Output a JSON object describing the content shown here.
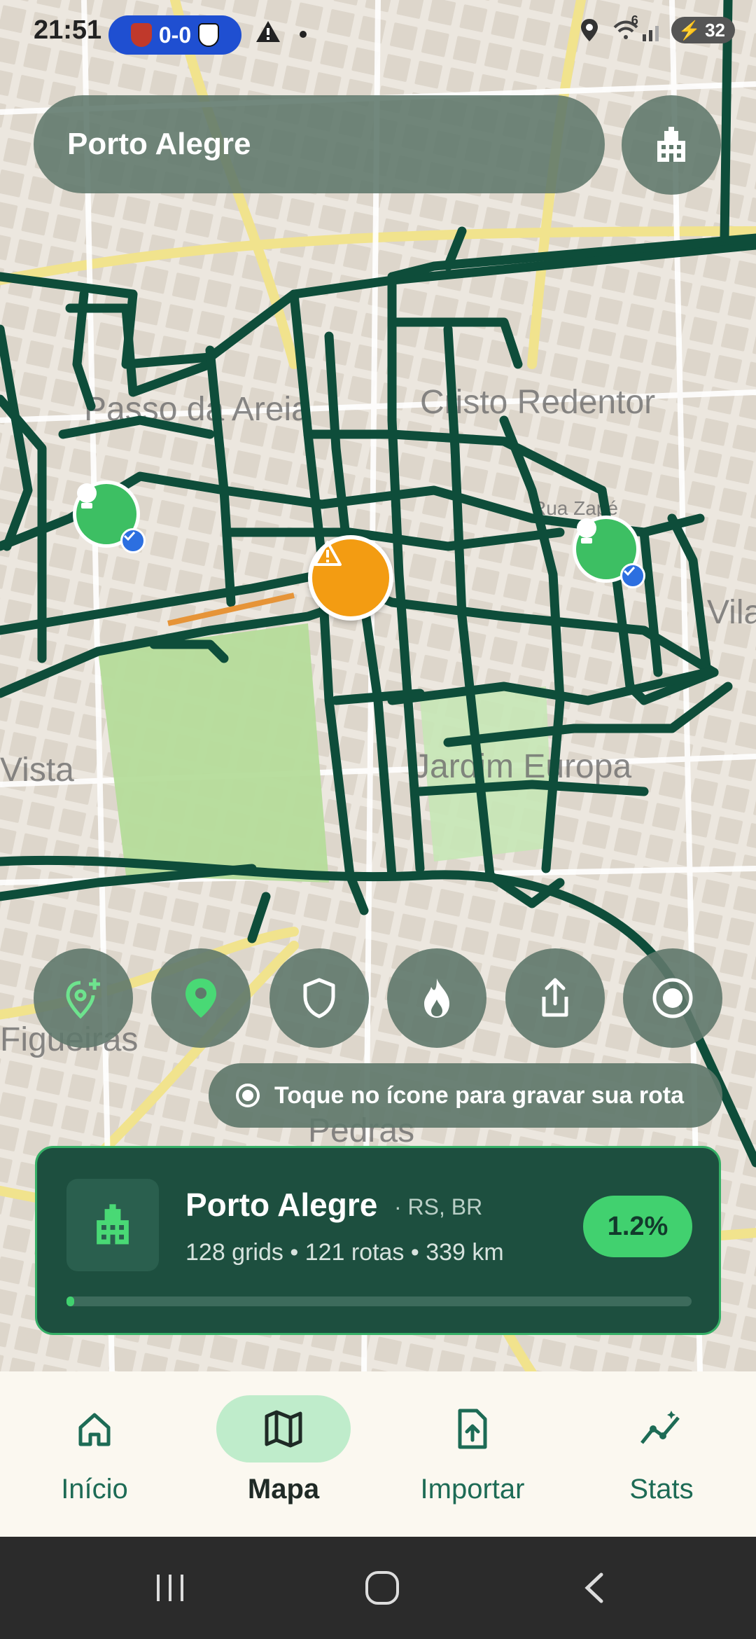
{
  "status_bar": {
    "time": "21:51",
    "score": "0-0",
    "network_label": "6",
    "battery": "32"
  },
  "search": {
    "city": "Porto Alegre"
  },
  "map": {
    "labels": [
      "Passo da Areia",
      "Cristo Redentor",
      "Rua Zapé",
      "Vila",
      "Vista",
      "Jardim Europa",
      "Figueiras",
      "Pedras"
    ],
    "route_color": "#0e4d3a"
  },
  "hint": {
    "text": "Toque no ícone para gravar sua rota"
  },
  "city_card": {
    "name": "Porto Alegre",
    "region": "· RS, BR",
    "stats": "128 grids • 121 rotas • 339 km",
    "percent_label": "1.2%",
    "progress_fraction": 0.012
  },
  "bottom_nav": {
    "items": [
      {
        "label": "Início",
        "icon": "home-icon",
        "active": false
      },
      {
        "label": "Mapa",
        "icon": "map-icon",
        "active": true
      },
      {
        "label": "Importar",
        "icon": "import-icon",
        "active": false
      },
      {
        "label": "Stats",
        "icon": "stats-icon",
        "active": false
      }
    ]
  },
  "colors": {
    "accent": "#41d16f",
    "card_bg": "#1d4f3f",
    "warning": "#f39c12"
  }
}
